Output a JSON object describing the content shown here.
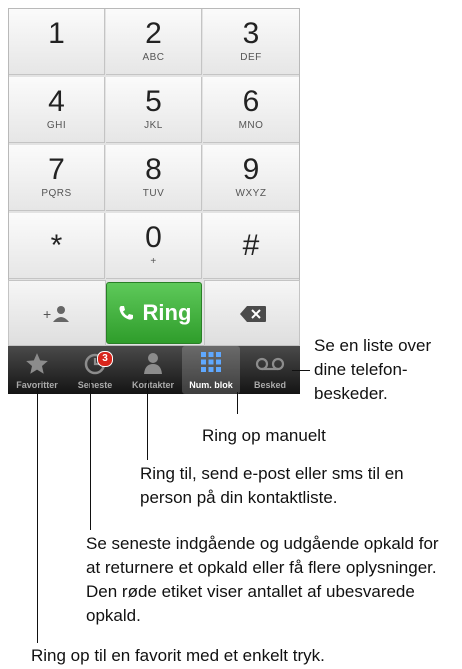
{
  "keypad": {
    "keys": [
      {
        "digit": "1",
        "letters": ""
      },
      {
        "digit": "2",
        "letters": "ABC"
      },
      {
        "digit": "3",
        "letters": "DEF"
      },
      {
        "digit": "4",
        "letters": "GHI"
      },
      {
        "digit": "5",
        "letters": "JKL"
      },
      {
        "digit": "6",
        "letters": "MNO"
      },
      {
        "digit": "7",
        "letters": "PQRS"
      },
      {
        "digit": "8",
        "letters": "TUV"
      },
      {
        "digit": "9",
        "letters": "WXYZ"
      },
      {
        "digit": "*",
        "letters": ""
      },
      {
        "digit": "0",
        "letters": "+"
      },
      {
        "digit": "#",
        "letters": ""
      }
    ],
    "call_label": "Ring"
  },
  "tabbar": {
    "tabs": [
      {
        "label": "Favoritter",
        "icon": "star-icon"
      },
      {
        "label": "Seneste",
        "icon": "clock-icon",
        "badge": "3"
      },
      {
        "label": "Kontakter",
        "icon": "person-icon"
      },
      {
        "label": "Num. blok",
        "icon": "keypad-icon"
      },
      {
        "label": "Besked",
        "icon": "voicemail-icon"
      }
    ]
  },
  "callouts": {
    "voicemail": "Se en liste over dine telefon-beskeder.",
    "keypad": "Ring op manuelt",
    "contacts": "Ring til, send e-post eller sms til en person på din kontaktliste.",
    "recents": "Se seneste indgående og udgående opkald for at returnere et opkald eller få flere oplysninger. Den røde etiket viser antallet af ubesvarede opkald.",
    "favorites": "Ring op til en favorit med et enkelt tryk."
  },
  "colors": {
    "call_green": "#34a530",
    "badge_red": "#d8261c"
  }
}
